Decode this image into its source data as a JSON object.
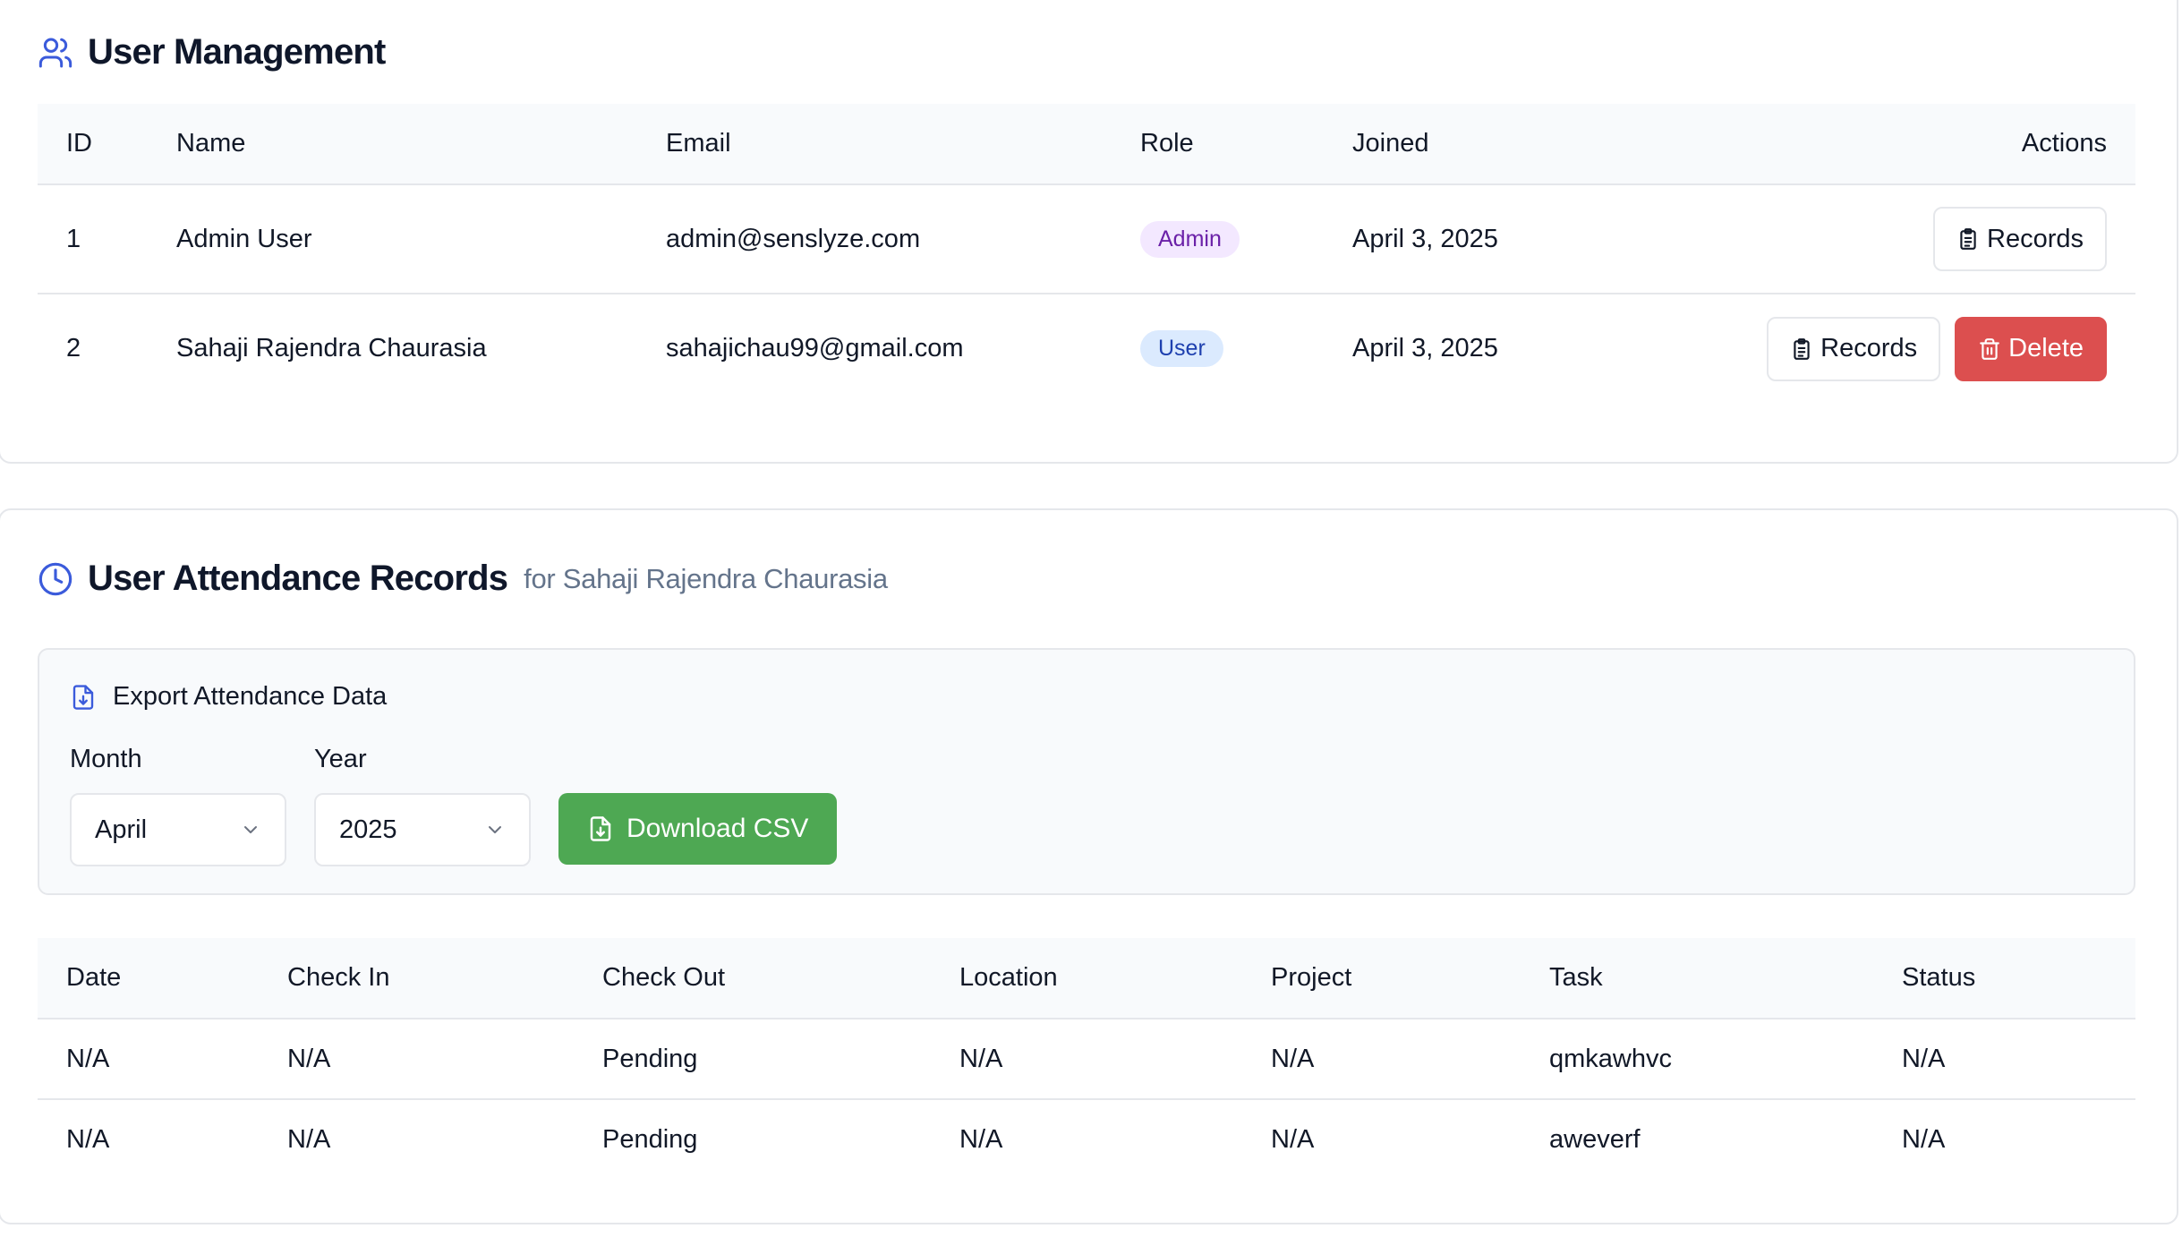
{
  "user_management": {
    "title": "User Management",
    "columns": [
      "ID",
      "Name",
      "Email",
      "Role",
      "Joined",
      "Actions"
    ],
    "rows": [
      {
        "id": "1",
        "name": "Admin User",
        "email": "admin@senslyze.com",
        "role": "Admin",
        "joined": "April 3, 2025",
        "records_label": "Records"
      },
      {
        "id": "2",
        "name": "Sahaji Rajendra Chaurasia",
        "email": "sahajichau99@gmail.com",
        "role": "User",
        "joined": "April 3, 2025",
        "records_label": "Records",
        "delete_label": "Delete"
      }
    ]
  },
  "attendance": {
    "title": "User Attendance Records",
    "subtitle": "for Sahaji Rajendra Chaurasia",
    "export": {
      "title": "Export Attendance Data",
      "month_label": "Month",
      "month_value": "April",
      "year_label": "Year",
      "year_value": "2025",
      "download_label": "Download CSV"
    },
    "columns": [
      "Date",
      "Check In",
      "Check Out",
      "Location",
      "Project",
      "Task",
      "Status"
    ],
    "rows": [
      {
        "date": "N/A",
        "check_in": "N/A",
        "check_out": "Pending",
        "location": "N/A",
        "project": "N/A",
        "task": "qmkawhvc",
        "status": "N/A"
      },
      {
        "date": "N/A",
        "check_in": "N/A",
        "check_out": "Pending",
        "location": "N/A",
        "project": "N/A",
        "task": "aweverf",
        "status": "N/A"
      }
    ]
  },
  "colors": {
    "accent_icon": "#3b5bdb",
    "admin_badge_bg": "#f3e8ff",
    "user_badge_bg": "#dbeafe",
    "delete_button": "#dc4f4f",
    "download_button": "#4ea853"
  },
  "icons": {
    "users": "users-icon",
    "clock": "clock-icon",
    "file_download": "file-download-icon",
    "clipboard": "clipboard-icon",
    "trash": "trash-icon",
    "chevron": "chevron-down-icon"
  }
}
